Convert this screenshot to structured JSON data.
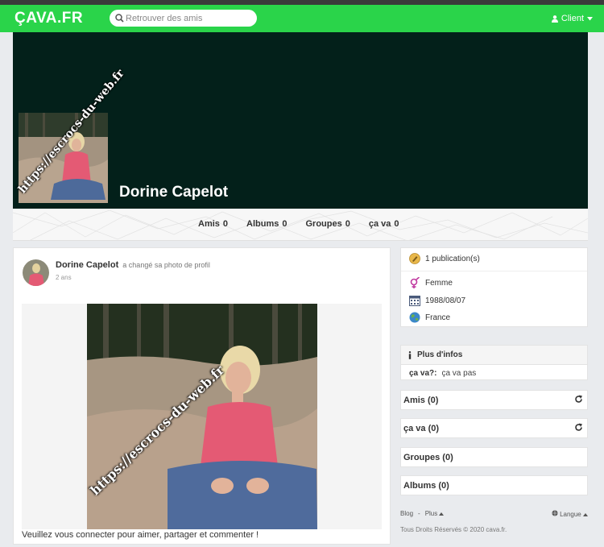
{
  "header": {
    "logo": "ÇAVA.FR",
    "search_placeholder": "Retrouver des amis",
    "client_label": "Client"
  },
  "profile": {
    "name": "Dorine Capelot",
    "watermark": "https://escrocs-du-web.fr"
  },
  "tabs": [
    {
      "label": "Amis",
      "count": "0"
    },
    {
      "label": "Albums",
      "count": "0"
    },
    {
      "label": "Groupes",
      "count": "0"
    },
    {
      "label": "ça va",
      "count": "0"
    }
  ],
  "post": {
    "author": "Dorine Capelot",
    "action": "a changé sa photo de profil",
    "time": "2 ans",
    "watermark": "https://escrocs-du-web.fr",
    "login_message": "Veuillez vous connecter pour aimer, partager et commenter !"
  },
  "info": {
    "publications": "1 publication(s)",
    "gender": "Femme",
    "birthdate": "1988/08/07",
    "country": "France"
  },
  "more_info": {
    "title": "Plus d'infos",
    "key": "ça va?:",
    "value": "ça va pas"
  },
  "widgets": {
    "amis": "Amis (0)",
    "cava": "ça va (0)",
    "groupes": "Groupes (0)",
    "albums": "Albums (0)"
  },
  "footer": {
    "blog": "Blog",
    "sep": "-",
    "plus": "Plus",
    "langue": "Langue",
    "copyright": "Tous Droits Réservés © 2020 cava.fr."
  },
  "colors": {
    "navbar": "#2ad44a",
    "cover": "#03201a"
  }
}
